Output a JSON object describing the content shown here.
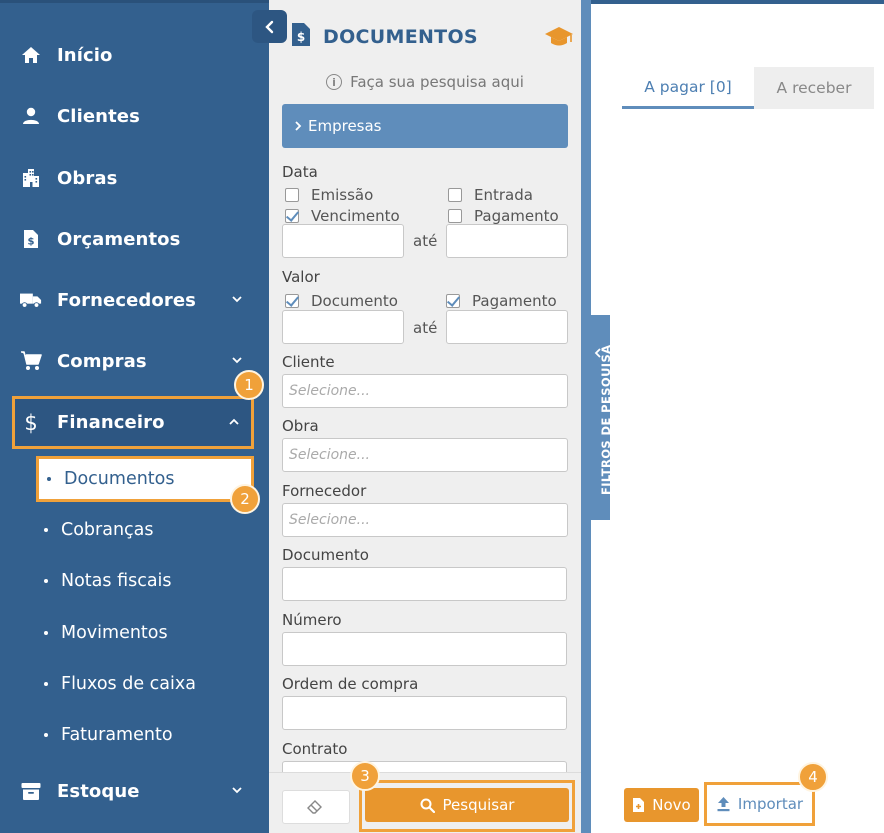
{
  "sidebar": {
    "items": [
      {
        "label": "Início",
        "icon": "home-icon"
      },
      {
        "label": "Clientes",
        "icon": "user-icon"
      },
      {
        "label": "Obras",
        "icon": "building-icon"
      },
      {
        "label": "Orçamentos",
        "icon": "document-dollar-icon"
      },
      {
        "label": "Fornecedores",
        "icon": "truck-icon"
      },
      {
        "label": "Compras",
        "icon": "cart-icon"
      },
      {
        "label": "Financeiro",
        "icon": "dollar-icon"
      },
      {
        "label": "Estoque",
        "icon": "archive-icon"
      }
    ],
    "financeiro_subitems": [
      "Documentos",
      "Cobranças",
      "Notas fiscais",
      "Movimentos",
      "Fluxos de caixa",
      "Faturamento"
    ]
  },
  "badges": [
    "1",
    "2",
    "3",
    "4"
  ],
  "panel": {
    "title": "DOCUMENTOS",
    "hint": "Faça sua pesquisa aqui",
    "accordion": "Empresas",
    "data_label": "Data",
    "data_checkboxes": [
      {
        "label": "Emissão",
        "checked": false
      },
      {
        "label": "Entrada",
        "checked": false
      },
      {
        "label": "Vencimento",
        "checked": true
      },
      {
        "label": "Pagamento",
        "checked": false
      }
    ],
    "ate": "até",
    "valor_label": "Valor",
    "valor_checkboxes": [
      {
        "label": "Documento",
        "checked": true
      },
      {
        "label": "Pagamento",
        "checked": true
      }
    ],
    "cliente_label": "Cliente",
    "obra_label": "Obra",
    "fornecedor_label": "Fornecedor",
    "select_placeholder": "Selecione...",
    "documento_label": "Documento",
    "numero_label": "Número",
    "ordem_label": "Ordem de compra",
    "contrato_label": "Contrato",
    "search_button": "Pesquisar"
  },
  "filter_tab_label": "FILTROS DE PESQUISA",
  "main": {
    "tabs": [
      "A pagar [0]",
      "A receber"
    ],
    "novo_button": "Novo",
    "import_button": "Importar"
  },
  "colors": {
    "sidebar": "#33608e",
    "accent": "#5f8dbb",
    "highlight": "#f0a13a",
    "primary_button": "#e8962d"
  }
}
